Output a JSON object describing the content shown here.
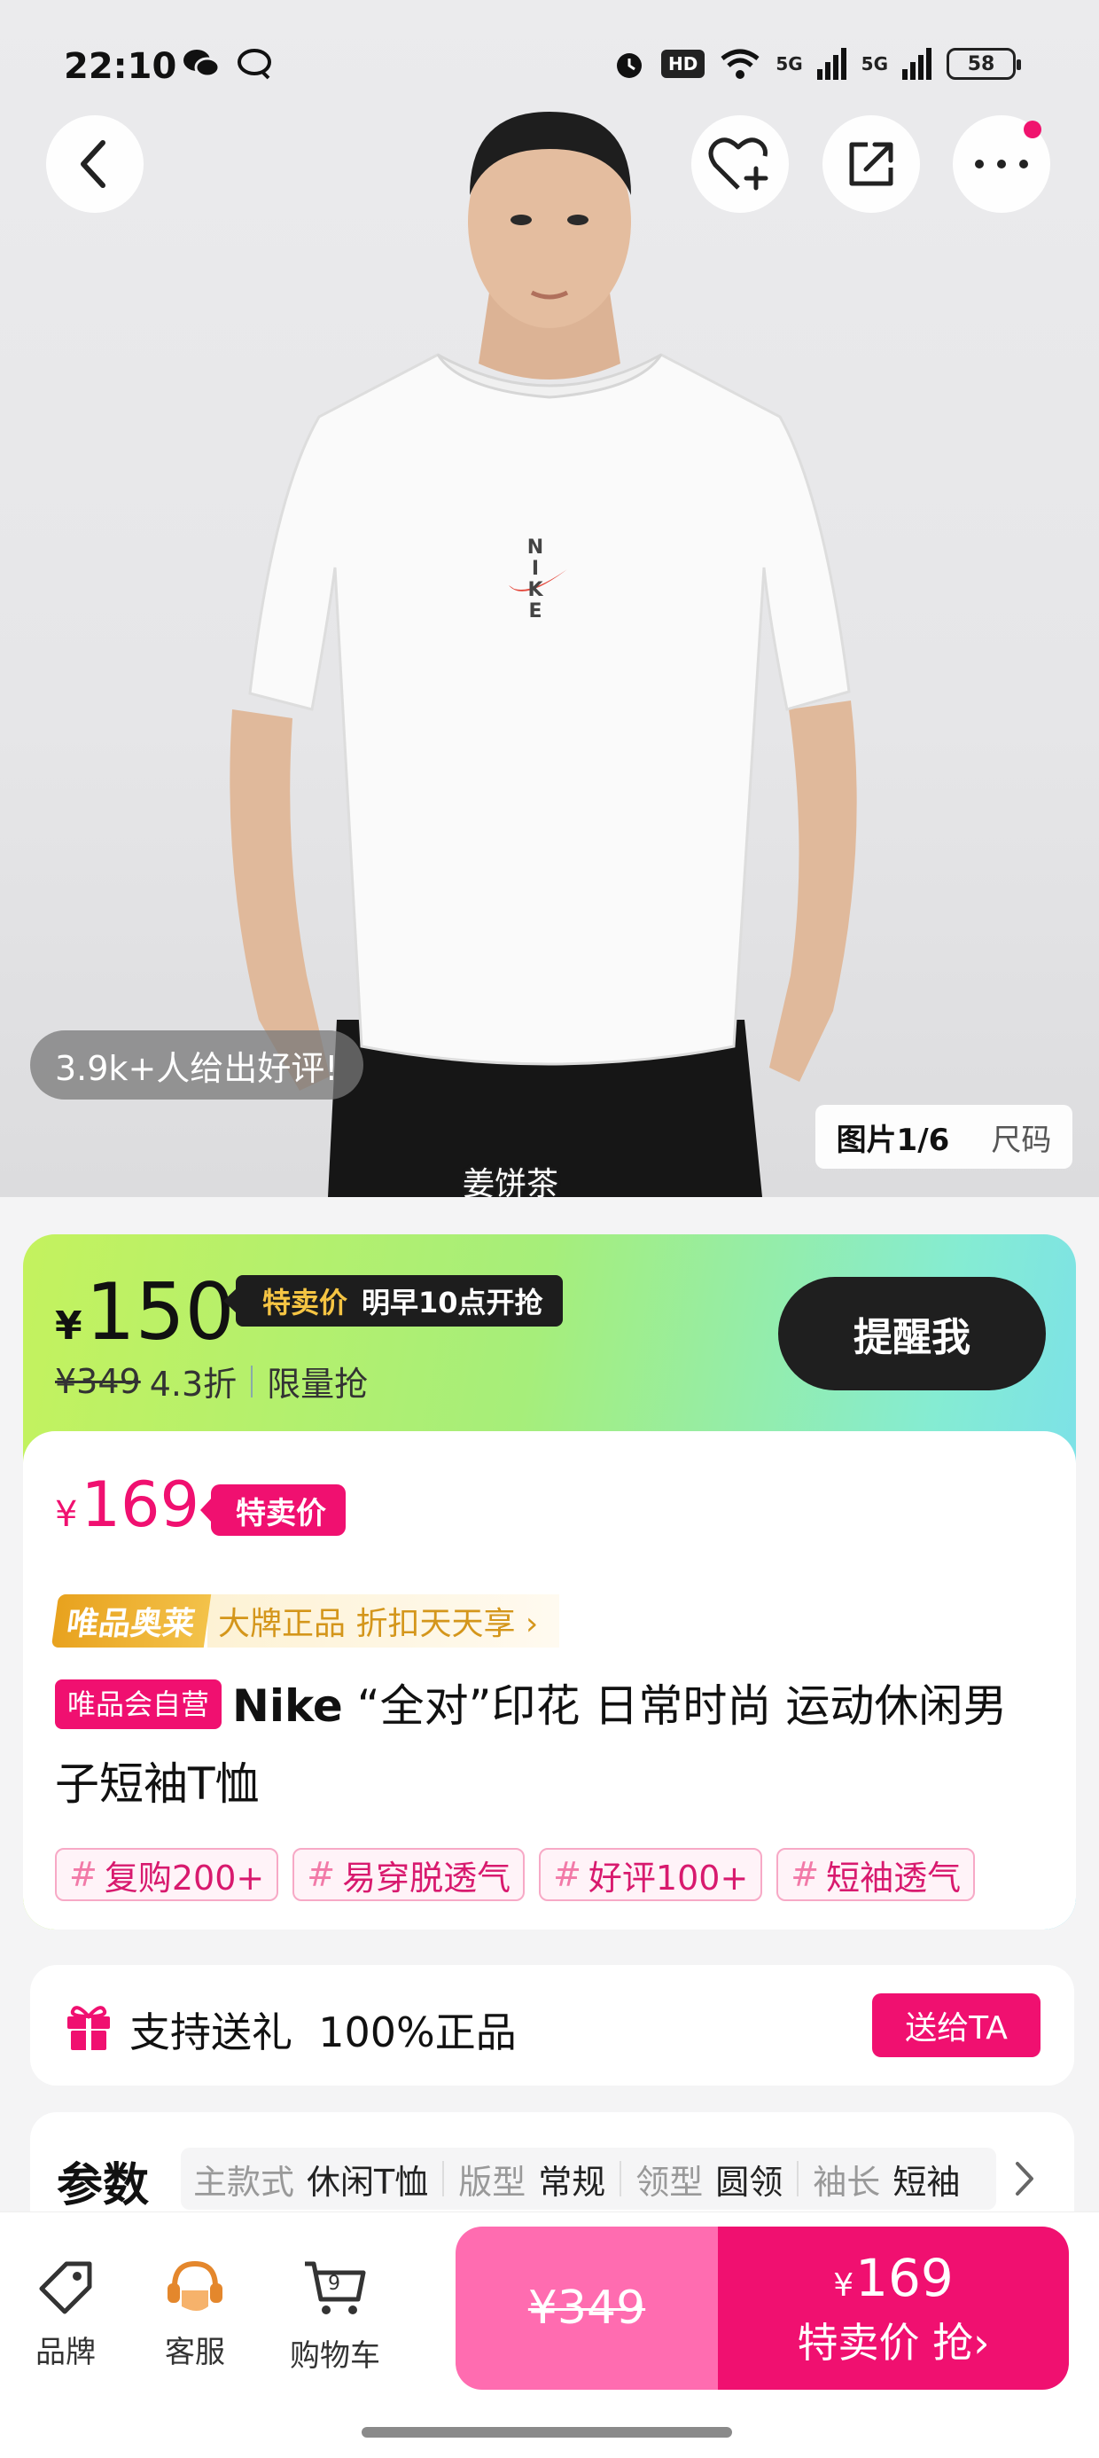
{
  "status_bar": {
    "time": "22:10",
    "left_icons": [
      "wechat-icon",
      "chat-bubble-icon"
    ],
    "right": {
      "hd": "HD",
      "net1": "5G",
      "net2": "5G",
      "battery": "58"
    }
  },
  "hero": {
    "review_pill": "3.9k+人给出好评!",
    "image_counter": {
      "images_label": "图片1/6",
      "size_label": "尺码"
    },
    "caption": "姜饼茶",
    "shirt_logo": "NIKE"
  },
  "presale": {
    "currency": "¥",
    "price": "150",
    "tag_highlight": "特卖价",
    "tag_text": "明早10点开抢",
    "original_price": "¥349",
    "discount": "4.3折",
    "limited": "限量抢",
    "remind_label": "提醒我"
  },
  "current": {
    "currency": "¥",
    "price": "169",
    "tag": "特卖价"
  },
  "outlet": {
    "badge": "唯品奥莱",
    "text": "大牌正品 折扣天天享 ›"
  },
  "title": {
    "self_tag": "唯品会自营",
    "brand": "Nike",
    "name": " “全对”印花 日常时尚 运动休闲男子短袖T恤"
  },
  "hashtags": [
    "复购200+",
    "易穿脱透气",
    "好评100+",
    "短袖透气"
  ],
  "hashtag_symbol": "#",
  "gift": {
    "text": "支持送礼  100%正品",
    "button": "送给TA"
  },
  "params": {
    "title": "参数",
    "items": [
      {
        "k": "主款式",
        "v": "休闲T恤"
      },
      {
        "k": "版型",
        "v": "常规"
      },
      {
        "k": "领型",
        "v": "圆领"
      },
      {
        "k": "袖长",
        "v": "短袖"
      }
    ]
  },
  "bottom_bar": {
    "nav": [
      {
        "label": "品牌",
        "icon": "tag-icon"
      },
      {
        "label": "客服",
        "icon": "customer-service-icon"
      },
      {
        "label": "购物车",
        "icon": "cart-icon",
        "count": "9"
      }
    ],
    "original_price": "¥349",
    "buy_currency": "¥",
    "buy_price": "169",
    "buy_action": "特卖价 抢›"
  },
  "colors": {
    "accent": "#f01070",
    "accent_light": "#ff6cb0",
    "outlet_gold": "#d4961b",
    "dark_button": "#1f1f1f"
  }
}
